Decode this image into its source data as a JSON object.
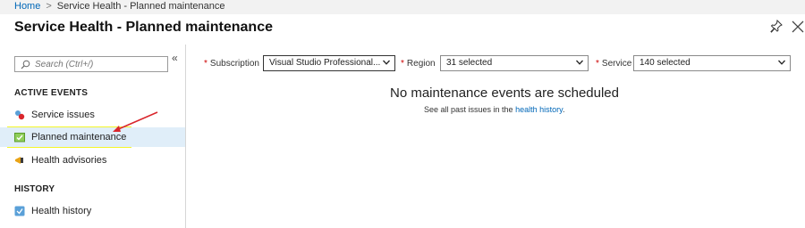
{
  "breadcrumb": {
    "home": "Home",
    "separator": ">",
    "current": "Service Health - Planned maintenance"
  },
  "blade": {
    "title": "Service Health - Planned maintenance",
    "collapse_glyph": "«"
  },
  "sidebar": {
    "search_placeholder": "Search (Ctrl+/)",
    "sections": [
      {
        "label": "ACTIVE EVENTS",
        "items": [
          {
            "label": "Service issues",
            "icon": "service-issues-icon"
          },
          {
            "label": "Planned maintenance",
            "icon": "planned-maintenance-icon",
            "selected": true
          },
          {
            "label": "Health advisories",
            "icon": "health-advisories-icon"
          }
        ]
      },
      {
        "label": "HISTORY",
        "items": [
          {
            "label": "Health history",
            "icon": "health-history-icon"
          }
        ]
      }
    ]
  },
  "filters": {
    "required_marker": "*",
    "subscription": {
      "label": "Subscription",
      "value": "Visual Studio Professional..."
    },
    "region": {
      "label": "Region",
      "value": "31 selected"
    },
    "service": {
      "label": "Service",
      "value": "140 selected"
    }
  },
  "main": {
    "empty_title": "No maintenance events are scheduled",
    "empty_sub_prefix": "See all past issues in the ",
    "empty_sub_link": "health history",
    "empty_sub_suffix": "."
  },
  "colors": {
    "accent": "#0067b8",
    "highlight": "#f5f62a",
    "selected_bg": "#e0eef9",
    "annotation_arrow": "#d9262c"
  }
}
